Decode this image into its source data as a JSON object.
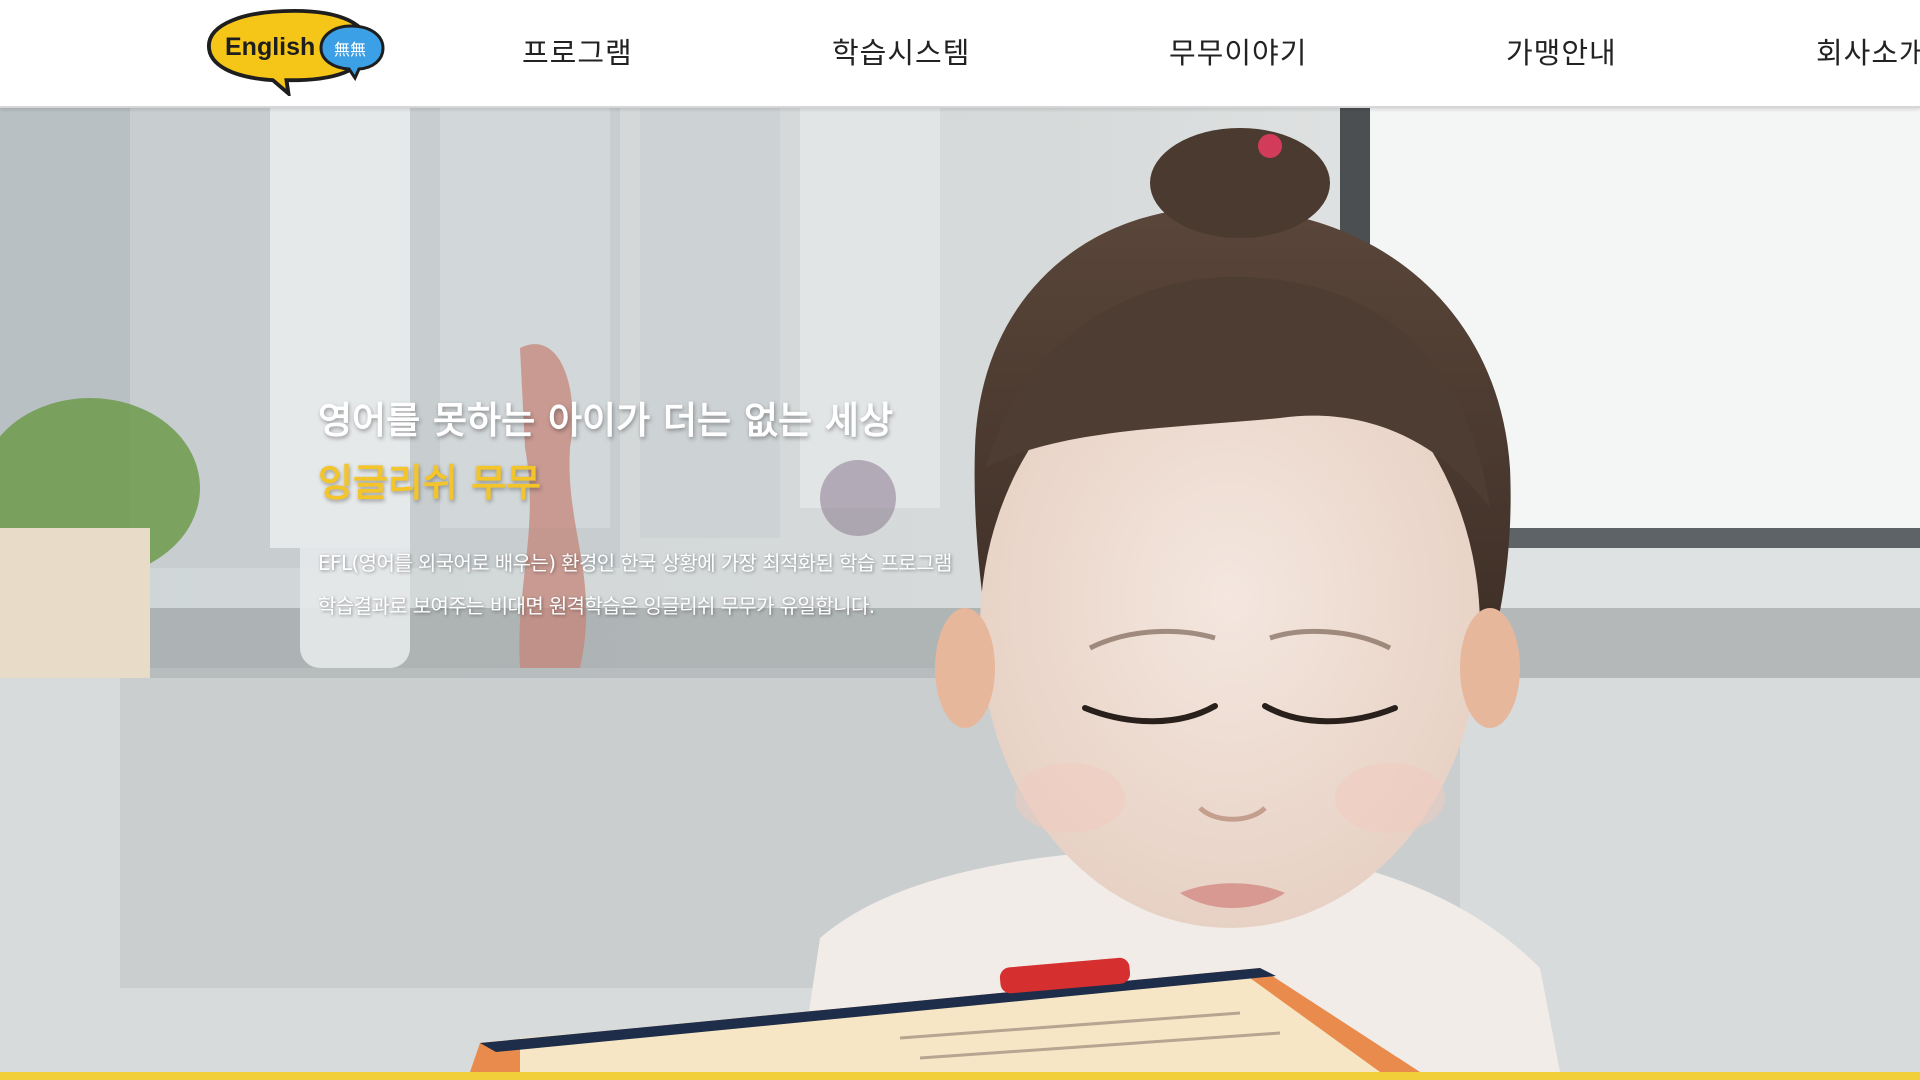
{
  "header": {
    "logo": {
      "text": "English",
      "badge_text": "無無",
      "colors": {
        "bubble": "#f5c518",
        "badge": "#3ba0e6",
        "outline": "#1e1e1e"
      }
    },
    "nav": [
      {
        "label": "프로그램"
      },
      {
        "label": "학습시스템"
      },
      {
        "label": "무무이야기"
      },
      {
        "label": "가맹안내"
      },
      {
        "label": "회사소개"
      }
    ]
  },
  "hero": {
    "headline": "영어를 못하는 아이가 더는 없는 세상",
    "brand_line": "잉글리쉬 무무",
    "desc_line_1": "EFL(영어를 외국어로 배우는) 환경인 한국 상황에 가장 최적화된 학습 프로그램",
    "desc_line_2": "학습결과로 보여주는 비대면 원격학습은 잉글리쉬 무무가 유일합니다.",
    "colors": {
      "accent": "#f3c52a",
      "bottom_bar": "#f0cf3a"
    }
  }
}
